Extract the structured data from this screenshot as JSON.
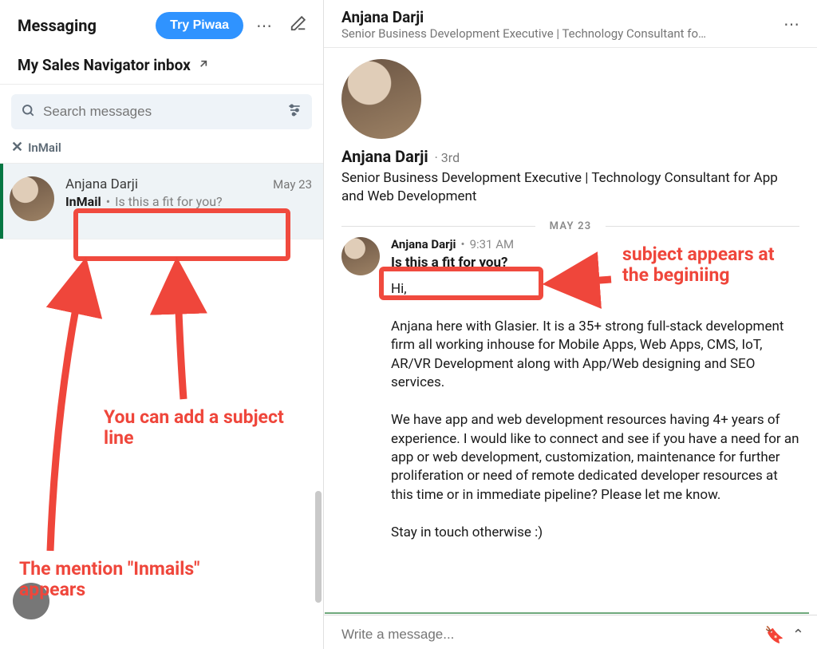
{
  "sidebar": {
    "title": "Messaging",
    "try_label": "Try Piwaa",
    "subheader": "My Sales Navigator inbox",
    "search_placeholder": "Search messages",
    "filter_chip": "InMail"
  },
  "conversation_list": [
    {
      "name": "Anjana Darji",
      "date": "May 23",
      "type_tag": "InMail",
      "preview": "Is this a fit for you?"
    }
  ],
  "thread": {
    "header_name": "Anjana Darji",
    "header_sub": "Senior Business Development Executive | Technology Consultant fo…",
    "profile_name": "Anjana Darji",
    "profile_degree": "· 3rd",
    "profile_title": "Senior Business Development Executive | Technology Consultant for App and Web Development",
    "date_divider": "MAY 23",
    "message": {
      "sender": "Anjana Darji",
      "time": "9:31 AM",
      "subject": "Is this a fit for you?",
      "body": "Hi,\n\nAnjana here with Glasier. It is a 35+ strong full-stack development firm all working inhouse for Mobile Apps, Web Apps, CMS, IoT, AR/VR Development along with App/Web designing and SEO services.\n\nWe have app and web development resources having 4+ years of experience. I would like to connect and see if you have a need for an app or web development, customization, maintenance for further proliferation or need of remote dedicated developer resources at this time or in immediate pipeline? Please let me know.\n\nStay in touch otherwise :)"
    },
    "composer_placeholder": "Write a message..."
  },
  "annotations": {
    "subject_line": "You can add a subject line",
    "inmail_mention": "The mention \"Inmails\" appears",
    "subject_appears": "subject appears at the beginiing"
  }
}
